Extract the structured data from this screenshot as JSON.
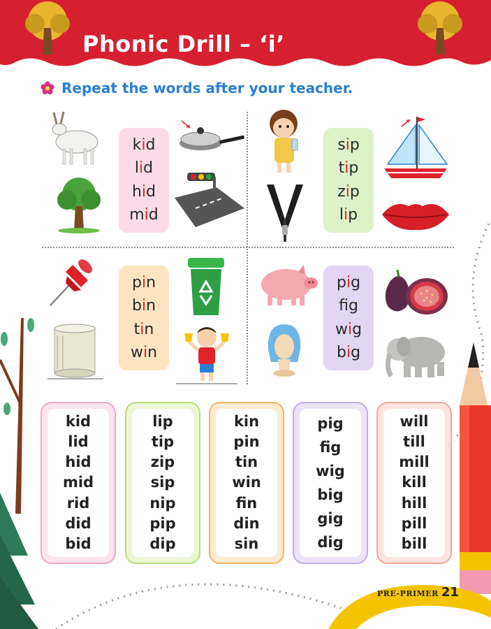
{
  "header": {
    "title": "Phonic Drill – ‘i’",
    "banner_color": "#d6202f"
  },
  "instruction": {
    "text": "Repeat the words after your teacher."
  },
  "quadrants": [
    {
      "id": "top-left",
      "color": "#fbdbe8",
      "words": [
        [
          "k",
          "i",
          "d"
        ],
        [
          "l",
          "i",
          "d"
        ],
        [
          "h",
          "i",
          "d"
        ],
        [
          "m",
          "i",
          "d"
        ]
      ],
      "pictures": [
        "goat",
        "tree",
        "frying-pan-lid",
        "traffic-light-road"
      ]
    },
    {
      "id": "top-right",
      "color": "#ddf2c8",
      "words": [
        [
          "s",
          "i",
          "p"
        ],
        [
          "t",
          "i",
          "p"
        ],
        [
          "z",
          "i",
          "p"
        ],
        [
          "l",
          "i",
          "p"
        ]
      ],
      "pictures": [
        "girl-sipping",
        "sailboat-tip",
        "zip",
        "lips"
      ]
    },
    {
      "id": "bottom-left",
      "color": "#fde4c0",
      "words": [
        [
          "p",
          "i",
          "n"
        ],
        [
          "b",
          "i",
          "n"
        ],
        [
          "t",
          "i",
          "n"
        ],
        [
          "w",
          "i",
          "n"
        ]
      ],
      "pictures": [
        "push-pin",
        "recycle-bin",
        "tin-can",
        "boy-trophy"
      ]
    },
    {
      "id": "bottom-right",
      "color": "#e2d6f3",
      "words": [
        [
          "p",
          "i",
          "g"
        ],
        [
          "f",
          "i",
          "g"
        ],
        [
          "w",
          "i",
          "g"
        ],
        [
          "b",
          "i",
          "g"
        ]
      ],
      "pictures": [
        "pig",
        "figs",
        "wig",
        "elephant"
      ]
    }
  ],
  "columns": [
    [
      "kid",
      "lid",
      "hid",
      "mid",
      "rid",
      "did",
      "bid"
    ],
    [
      "lip",
      "tip",
      "zip",
      "sip",
      "nip",
      "pip",
      "dip"
    ],
    [
      "kin",
      "pin",
      "tin",
      "win",
      "fin",
      "din",
      "sin"
    ],
    [
      "pig",
      "fig",
      "wig",
      "big",
      "gig",
      "dig"
    ],
    [
      "will",
      "till",
      "mill",
      "kill",
      "hill",
      "pill",
      "bill"
    ]
  ],
  "footer": {
    "label": "PRE-PRIMER",
    "page": "21"
  }
}
